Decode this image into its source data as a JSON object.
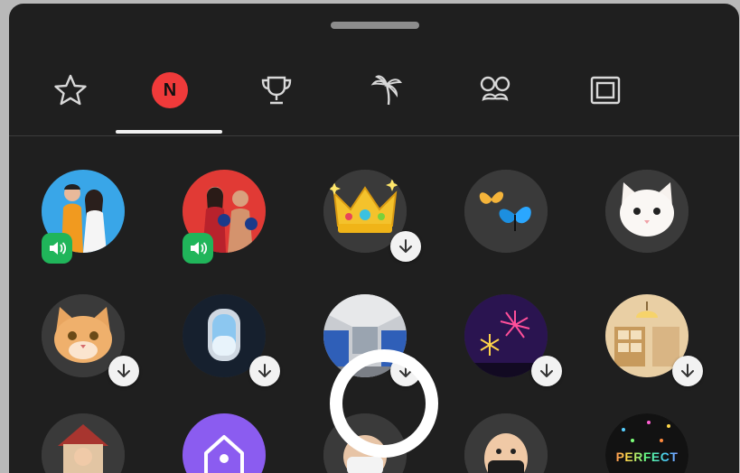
{
  "tabs": [
    {
      "name": "favorites",
      "icon": "star-icon"
    },
    {
      "name": "new",
      "icon": "new-badge-icon",
      "label": "N",
      "selected": true
    },
    {
      "name": "popular",
      "icon": "trophy-icon"
    },
    {
      "name": "travel",
      "icon": "palm-tree-icon"
    },
    {
      "name": "funny",
      "icon": "glasses-mustache-icon"
    },
    {
      "name": "frames",
      "icon": "frame-icon"
    }
  ],
  "effects_rows": [
    [
      {
        "icon": "couple-photo-effect-icon",
        "badge": "sound"
      },
      {
        "icon": "boxing-pair-effect-icon",
        "badge": "sound"
      },
      {
        "icon": "crown-effect-icon",
        "badge": "download"
      },
      {
        "icon": "butterflies-effect-icon"
      },
      {
        "icon": "white-cat-effect-icon"
      }
    ],
    [
      {
        "icon": "orange-cat-effect-icon",
        "badge": "download"
      },
      {
        "icon": "airplane-window-effect-icon",
        "badge": "download"
      },
      {
        "icon": "train-interior-effect-icon",
        "badge": "download"
      },
      {
        "icon": "fireworks-effect-icon",
        "badge": "download"
      },
      {
        "icon": "cozy-room-effect-icon",
        "badge": "download"
      }
    ],
    [
      {
        "icon": "house-girl-effect-icon"
      },
      {
        "icon": "purple-house-effect-icon"
      },
      {
        "icon": "masked-person-effect-icon"
      },
      {
        "icon": "bald-masked-effect-icon"
      },
      {
        "icon": "perfect-text-effect-icon",
        "label": "PERFECT"
      }
    ]
  ],
  "colors": {
    "sheet_bg": "#1f1f1f",
    "new_badge": "#f03a3a",
    "sound_badge": "#20b55a"
  }
}
